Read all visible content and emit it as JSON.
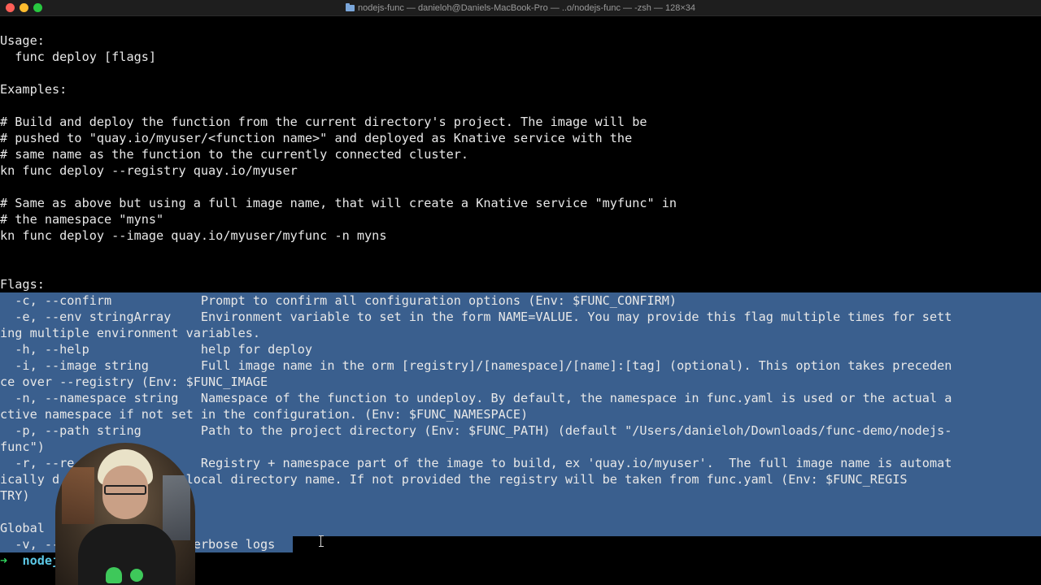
{
  "window": {
    "title": "nodejs-func — danieloh@Daniels-MacBook-Pro — ..o/nodejs-func — -zsh — 128×34"
  },
  "terminal": {
    "lines": [
      "Usage:",
      "  func deploy [flags]",
      "",
      "Examples:",
      "",
      "# Build and deploy the function from the current directory's project. The image will be",
      "# pushed to \"quay.io/myuser/<function name>\" and deployed as Knative service with the",
      "# same name as the function to the currently connected cluster.",
      "kn func deploy --registry quay.io/myuser",
      "",
      "# Same as above but using a full image name, that will create a Knative service \"myfunc\" in",
      "# the namespace \"myns\"",
      "kn func deploy --image quay.io/myuser/myfunc -n myns",
      "",
      "",
      "Flags:",
      "  -c, --confirm            Prompt to confirm all configuration options (Env: $FUNC_CONFIRM)",
      "  -e, --env stringArray    Environment variable to set in the form NAME=VALUE. You may provide this flag multiple times for sett",
      "ing multiple environment variables.",
      "  -h, --help               help for deploy",
      "  -i, --image string       Full image name in the orm [registry]/[namespace]/[name]:[tag] (optional). This option takes preceden",
      "ce over --registry (Env: $FUNC_IMAGE",
      "  -n, --namespace string   Namespace of the function to undeploy. By default, the namespace in func.yaml is used or the actual a",
      "ctive namespace if not set in the configuration. (Env: $FUNC_NAMESPACE)",
      "  -p, --path string        Path to the project directory (Env: $FUNC_PATH) (default \"/Users/danieloh/Downloads/func-demo/nodejs-",
      "func\")",
      "  -r, --re           ng    Registry + namespace part of the image to build, ex 'quay.io/myuser'.  The full image name is automat",
      "ically d          on the local directory name. If not provided the registry will be taken from func.yaml (Env: $FUNC_REGIS",
      "TRY)",
      "",
      "Global",
      "  -v, --                 verbose logs"
    ],
    "prompt_arrow": "➜",
    "prompt_dir": "nodejs"
  },
  "colors": {
    "background": "#000000",
    "text": "#e8e8e8",
    "selection": "#3a5f8e",
    "prompt_arrow": "#2fd15c",
    "prompt_dir": "#5cc8e6"
  }
}
